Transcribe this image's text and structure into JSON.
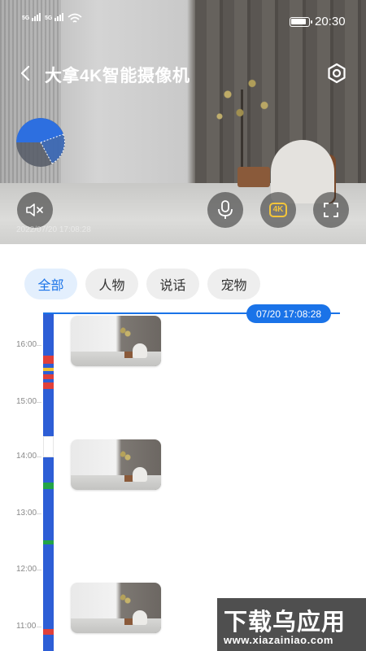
{
  "status_bar": {
    "sim1": "5G",
    "sim2": "5G",
    "time": "20:30"
  },
  "header": {
    "title": "大拿4K智能摄像机",
    "back_icon": "chevron-left-icon",
    "settings_icon": "gear-icon"
  },
  "player": {
    "timestamp": "2022/07/20 17:08:28",
    "mute_icon": "speaker-muted-icon",
    "mic_icon": "microphone-icon",
    "quality_label": "4K",
    "fullscreen_icon": "fullscreen-icon",
    "ptz_icon": "ptz-direction-icon"
  },
  "filters": {
    "chips": [
      "全部",
      "人物",
      "说话",
      "宠物"
    ],
    "active": "全部"
  },
  "timeline": {
    "current_time": "07/20 17:08:28",
    "hour_labels": [
      "16:00",
      "15:00",
      "14:00",
      "13:00",
      "12:00",
      "11:00"
    ],
    "event_colors": {
      "person": "#e0403a",
      "talk": "#f2c230",
      "pet": "#22a447",
      "motion": "#2d5ed6"
    }
  },
  "watermark": {
    "line1": "下载乌应用",
    "line2": "www.xiazainiao.com"
  }
}
